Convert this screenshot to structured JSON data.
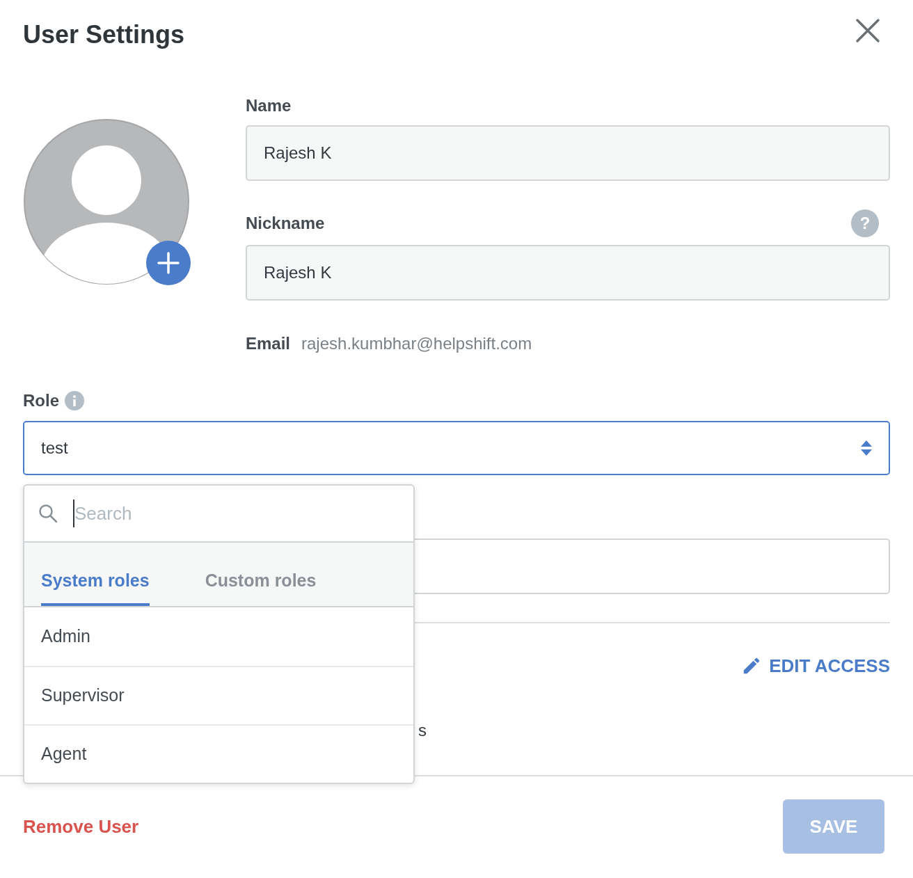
{
  "dialog": {
    "title": "User Settings"
  },
  "fields": [
    {
      "label": "Name",
      "value": "Rajesh K"
    },
    {
      "label": "Nickname",
      "value": "Rajesh K",
      "help": "?"
    }
  ],
  "email": {
    "label": "Email",
    "value": "rajesh.kumbhar@helpshift.com"
  },
  "role": {
    "label": "Role",
    "value": "test",
    "open": true
  },
  "role_menu": {
    "search": {
      "placeholder": "Search"
    },
    "tabs": [
      {
        "label": "System roles",
        "selected": true
      },
      {
        "label": "Custom roles",
        "selected": false
      }
    ],
    "items": [
      "Admin",
      "Supervisor",
      "Agent"
    ]
  },
  "edit_access": "EDIT ACCESS",
  "text_fragment": "s",
  "footer": {
    "remove": "Remove User",
    "save": {
      "label": "SAVE",
      "disabled": true
    }
  }
}
